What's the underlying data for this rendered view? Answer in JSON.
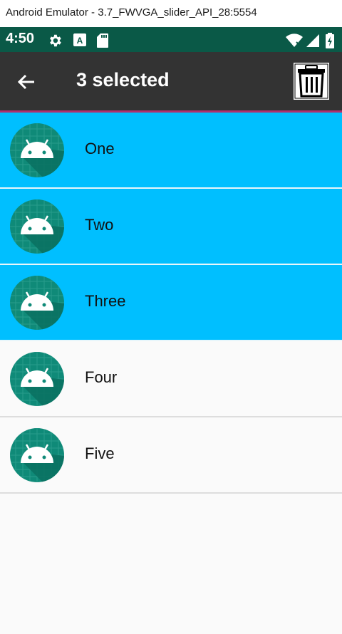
{
  "window": {
    "title": "Android Emulator - 3.7_FWVGA_slider_API_28:5554"
  },
  "status_bar": {
    "time": "4:50",
    "background": "#0a5947",
    "icons": [
      "settings-gear-icon",
      "a-keyboard-icon",
      "sd-card-icon",
      "wifi-icon",
      "signal-icon",
      "battery-icon"
    ]
  },
  "toolbar": {
    "title": "3 selected",
    "background": "#333333",
    "accent": "#b0306e",
    "back_icon": "arrow-back-icon",
    "delete_icon": "trash-icon"
  },
  "list": {
    "selected_color": "#00bfff",
    "items": [
      {
        "label": "One",
        "selected": true
      },
      {
        "label": "Two",
        "selected": true
      },
      {
        "label": "Three",
        "selected": true
      },
      {
        "label": "Four",
        "selected": false
      },
      {
        "label": "Five",
        "selected": false
      }
    ]
  }
}
